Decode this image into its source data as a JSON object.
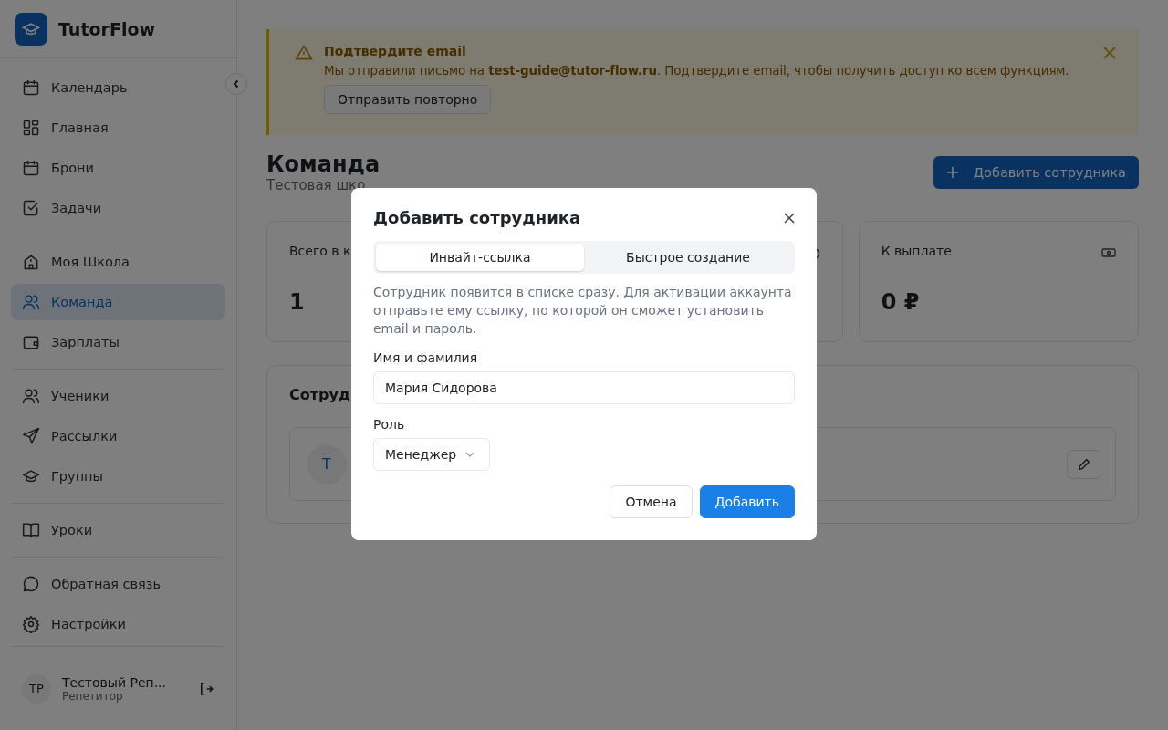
{
  "sidebar": {
    "brand": "TutorFlow",
    "nav_groups": [
      [
        {
          "label": "Календарь",
          "selected": false
        },
        {
          "label": "Главная",
          "selected": false
        },
        {
          "label": "Брони",
          "selected": false
        },
        {
          "label": "Задачи",
          "selected": false
        }
      ],
      [
        {
          "label": "Моя Школа",
          "selected": false
        },
        {
          "label": "Команда",
          "selected": true
        },
        {
          "label": "Зарплаты",
          "selected": false
        }
      ],
      [
        {
          "label": "Ученики",
          "selected": false
        },
        {
          "label": "Рассылки",
          "selected": false
        },
        {
          "label": "Группы",
          "selected": false
        }
      ],
      [
        {
          "label": "Уроки",
          "selected": false
        }
      ],
      [
        {
          "label": "Обратная связь",
          "selected": false
        },
        {
          "label": "Настройки",
          "selected": false
        }
      ]
    ],
    "user": {
      "initials": "ТР",
      "name": "Тестовый Реп...",
      "role": "Репетитор"
    }
  },
  "banner": {
    "title": "Подтвердите email",
    "message": "Мы отправили письмо на **test-guide@tutor-flow.ru**. Подтвердите email, чтобы получить доступ ко всем функциям.",
    "button": "Отправить повторно"
  },
  "page": {
    "title": "Команда",
    "subtitle": "Тестовая шко",
    "add_button": "Добавить сотрудника"
  },
  "stats": [
    {
      "label": "Всего в к",
      "value": "1"
    },
    {
      "label": "К выплате",
      "value": "0 ₽"
    }
  ],
  "staff": {
    "title": "Сотруд",
    "member_initials": "Т"
  },
  "modal": {
    "title": "Добавить сотрудника",
    "tabs": [
      {
        "label": "Инвайт-ссылка",
        "selected": true
      },
      {
        "label": "Быстрое создание",
        "selected": false
      }
    ],
    "description": "Сотрудник появится в списке сразу. Для активации аккаунта отправьте ему ссылку, по которой он сможет установить email и пароль.",
    "name_field": {
      "label": "Имя и фамилия",
      "value": "Мария Сидорова"
    },
    "role_field": {
      "label": "Роль",
      "value": "Менеджер"
    },
    "buttons": [
      {
        "label": "Отмена",
        "kind": "secondary"
      },
      {
        "label": "Добавить",
        "kind": "primary"
      }
    ]
  }
}
